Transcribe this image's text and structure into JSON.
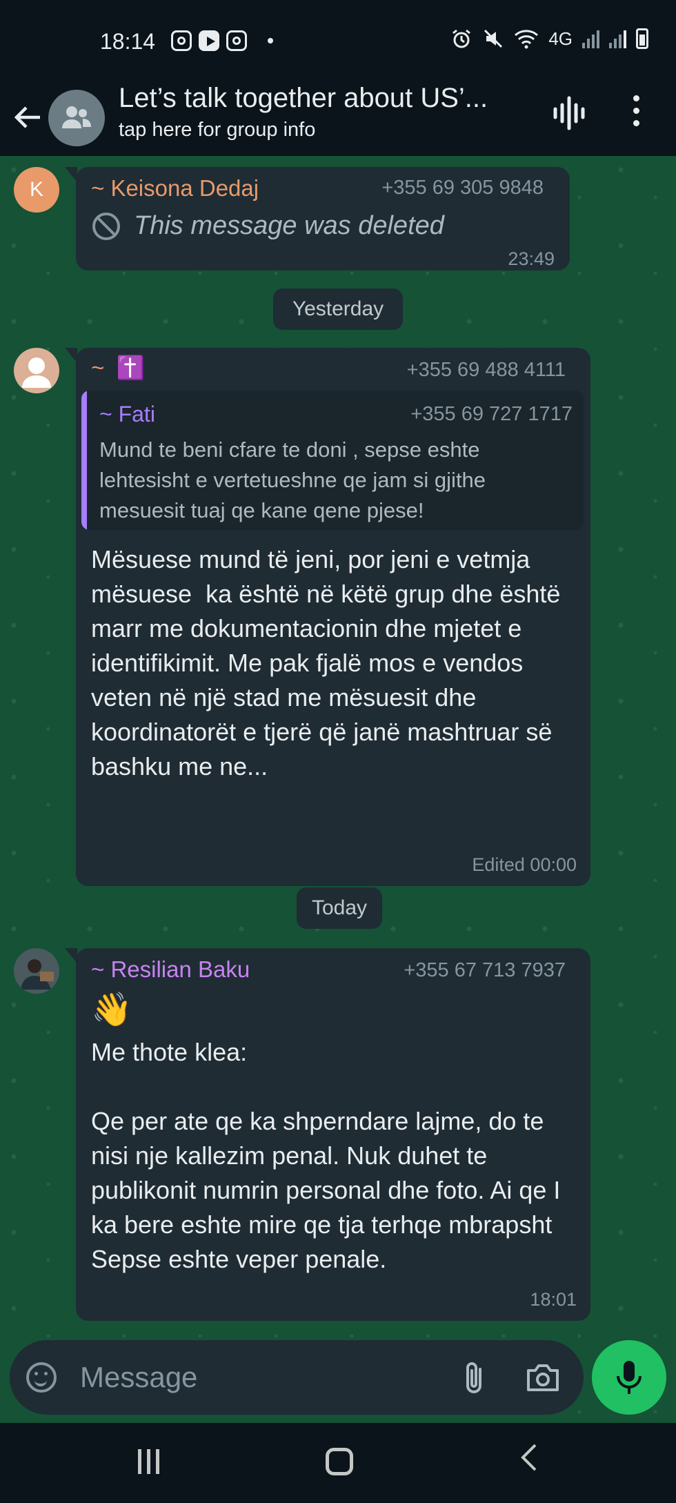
{
  "status_bar": {
    "time": "18:14",
    "network": "4G",
    "icons": [
      "instagram-icon",
      "youtube-icon",
      "instagram-icon",
      "alarm-icon",
      "mute-icon",
      "wifi-icon",
      "signal-icon",
      "battery-icon"
    ]
  },
  "header": {
    "title": "Let’s talk together about US’...",
    "subtitle": "tap here for group info",
    "icons": [
      "back-arrow-icon",
      "group-avatar-icon",
      "voice-chat-icon",
      "more-options-icon"
    ]
  },
  "messages": [
    {
      "sender": "~ Keisona Dedaj",
      "avatar_letter": "K",
      "avatar_color": "#e89a6a",
      "sender_color": "#e89a6a",
      "phone": "+355 69 305 9848",
      "deleted_text": "This message was deleted",
      "time": "23:49"
    },
    {
      "date_chip": "Yesterday"
    },
    {
      "sender": "~",
      "sender_emoji": "✝️",
      "phone": "+355 69 488 4111",
      "quote": {
        "sender": "~ Fati",
        "phone": "+355 69 727 1717",
        "text": "Mund te beni cfare te doni , sepse eshte lehtesisht e vertetueshne qe jam si gjithe mesuesit tuaj qe kane qene pjese!",
        "color": "#a77eff"
      },
      "text": "Mësuese mund të jeni, por jeni e vetmja mësuese  ka është në këtë grup dhe është marr me dokumentacionin dhe mjetet e identifikimit. Me pak fjalë mos e vendos veten në një stad me mësuesit dhe koordinatorët e tjerë që janë mashtruar së bashku me ne...",
      "time": "Edited 00:00"
    },
    {
      "date_chip": "Today"
    },
    {
      "sender": "~ Resilian Baku",
      "sender_color": "#c783f2",
      "phone": "+355 67 713 7937",
      "emoji": "👋",
      "text": "Me thote klea:\n\nQe per ate qe ka shperndare lajme, do te nisi nje kallezim penal. Nuk duhet te publikonit numrin personal dhe foto. Ai qe I ka bere eshte mire qe tja terhqe mbrapsht Sepse eshte veper penale.",
      "time": "18:01"
    }
  ],
  "composer": {
    "placeholder": "Message"
  },
  "colors": {
    "chat_background": "#155236",
    "bubble": "#1f2c34",
    "send_button": "#21c063"
  }
}
